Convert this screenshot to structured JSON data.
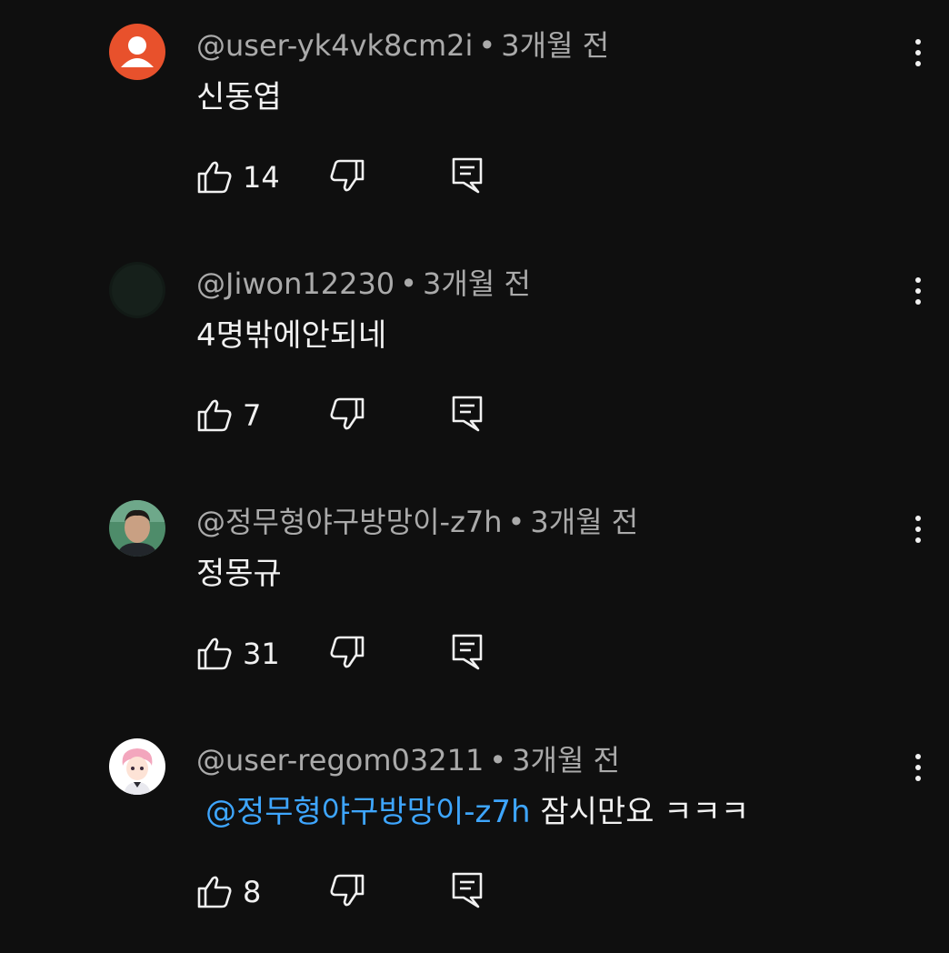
{
  "comments": [
    {
      "author": "@user-yk4vk8cm2i",
      "time": "3개월 전",
      "text": "신동엽",
      "mention": "",
      "likes": "14",
      "avatar": "default-person-avatar",
      "avatar_color": "#e8512c"
    },
    {
      "author": "@Jiwon12230",
      "time": "3개월 전",
      "text": "4명밖에안되네",
      "mention": "",
      "likes": "7",
      "avatar": "dark-avatar",
      "avatar_color": "#121a16"
    },
    {
      "author": "@정무형야구방망이-z7h",
      "time": "3개월 전",
      "text": "정몽규",
      "mention": "",
      "likes": "31",
      "avatar": "photo-avatar",
      "avatar_color": "#4e8c6a"
    },
    {
      "author": "@user-regom03211",
      "time": "3개월 전",
      "text": "잠시만요 ㅋㅋㅋ",
      "mention": "@정무형야구방망이-z7h",
      "likes": "8",
      "avatar": "anime-character-avatar",
      "avatar_color": "#ffffff"
    }
  ],
  "separator": "•",
  "colors": {
    "background": "#0f0f0f",
    "text": "#f1f1f1",
    "meta": "#aaaaaa",
    "mention": "#3ea6ff"
  },
  "icons": {
    "like": "thumbs-up-icon",
    "dislike": "thumbs-down-icon",
    "reply": "reply-comment-icon",
    "menu": "more-vertical-icon"
  }
}
